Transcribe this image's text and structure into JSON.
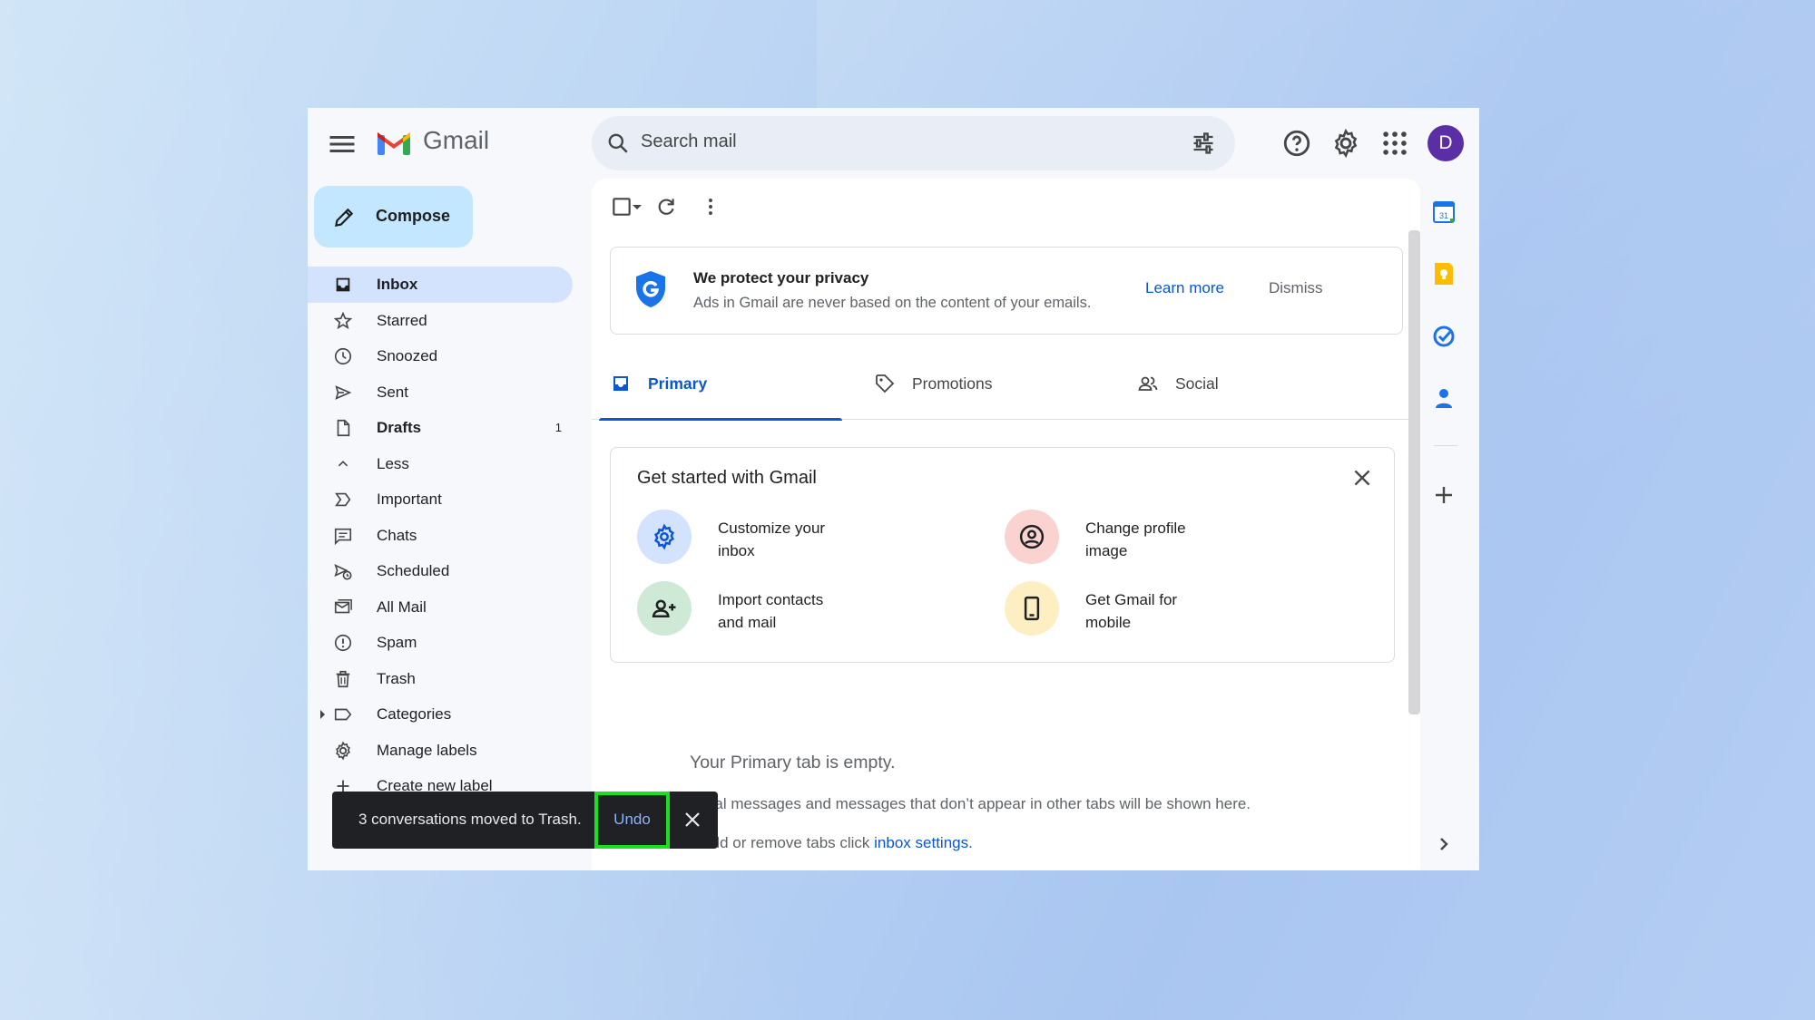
{
  "app": {
    "name": "Gmail",
    "avatar_initial": "D"
  },
  "search": {
    "placeholder": "Search mail"
  },
  "compose": {
    "label": "Compose"
  },
  "sidebar": {
    "items": [
      {
        "label": "Inbox",
        "icon": "inbox-icon",
        "active": true
      },
      {
        "label": "Starred",
        "icon": "star-icon"
      },
      {
        "label": "Snoozed",
        "icon": "clock-icon"
      },
      {
        "label": "Sent",
        "icon": "send-icon"
      },
      {
        "label": "Drafts",
        "icon": "draft-icon",
        "count": "1"
      },
      {
        "label": "Less",
        "icon": "chevron-up-icon"
      },
      {
        "label": "Important",
        "icon": "important-icon"
      },
      {
        "label": "Chats",
        "icon": "chat-icon"
      },
      {
        "label": "Scheduled",
        "icon": "scheduled-icon"
      },
      {
        "label": "All Mail",
        "icon": "all-mail-icon"
      },
      {
        "label": "Spam",
        "icon": "spam-icon"
      },
      {
        "label": "Trash",
        "icon": "trash-icon"
      },
      {
        "label": "Categories",
        "icon": "label-icon"
      },
      {
        "label": "Manage labels",
        "icon": "gear-icon"
      },
      {
        "label": "Create new label",
        "icon": "plus-icon"
      }
    ]
  },
  "privacy": {
    "title": "We protect your privacy",
    "subtitle": "Ads in Gmail are never based on the content of your emails.",
    "learn_more": "Learn more",
    "dismiss": "Dismiss"
  },
  "tabs": [
    {
      "label": "Primary",
      "active": true
    },
    {
      "label": "Promotions"
    },
    {
      "label": "Social"
    }
  ],
  "get_started": {
    "title": "Get started with Gmail",
    "items": [
      {
        "line1": "Customize your",
        "line2": "inbox"
      },
      {
        "line1": "Change profile",
        "line2": "image"
      },
      {
        "line1": "Import contacts",
        "line2": "and mail"
      },
      {
        "line1": "Get Gmail for",
        "line2": "mobile"
      }
    ]
  },
  "empty": {
    "title": "Your Primary tab is empty.",
    "line1": "sonal messages and messages that don’t appear in other tabs will be shown here.",
    "line2_prefix": "o add or remove tabs click ",
    "line2_link": "inbox settings."
  },
  "snackbar": {
    "message": "3 conversations moved to Trash.",
    "undo": "Undo"
  },
  "colors": {
    "accent": "#0b57d0",
    "compose_bg": "#c2e7ff",
    "active_nav": "#d3e3fd",
    "highlight_box": "#19e020"
  }
}
